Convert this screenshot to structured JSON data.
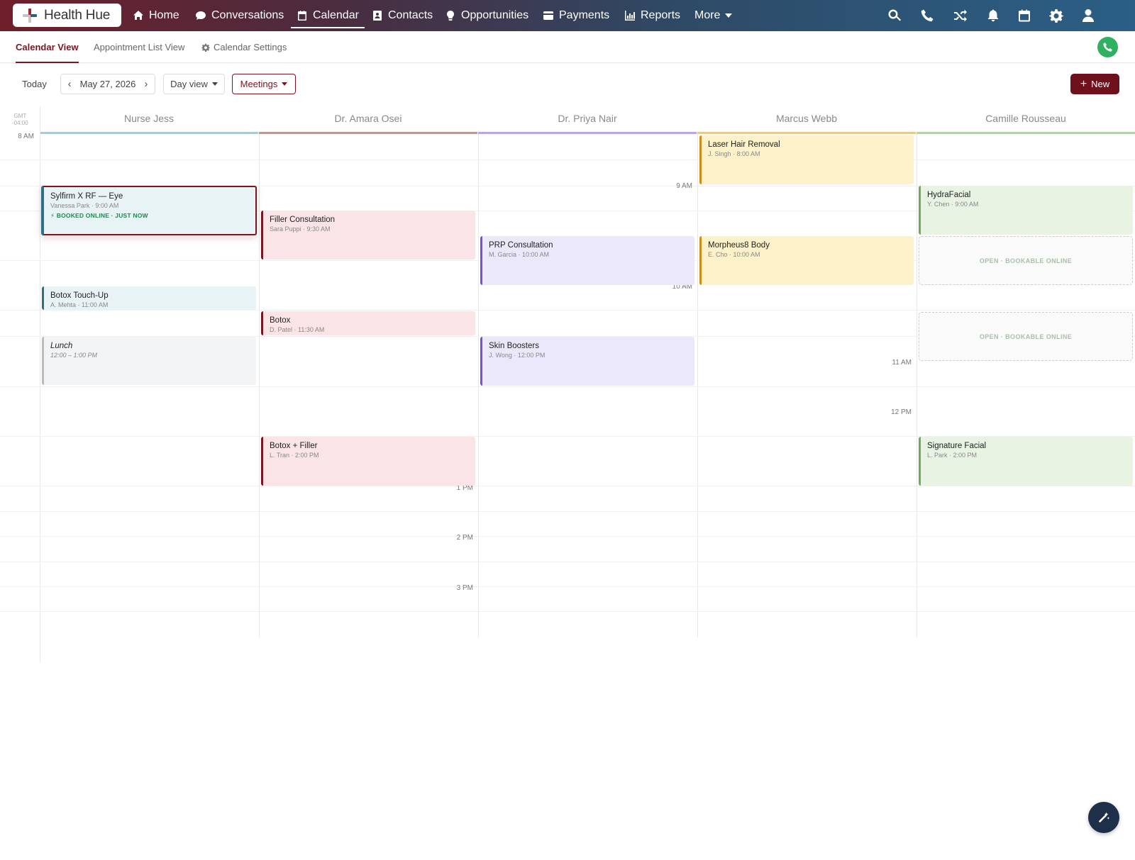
{
  "brand": {
    "name": "Health Hue",
    "colors": {
      "accent": "#7a1522",
      "nav_start": "#6e1f2a",
      "nav_end": "#2b5f86",
      "success": "#2fb160"
    }
  },
  "nav": {
    "items": [
      {
        "label": "Home",
        "icon": "home-icon"
      },
      {
        "label": "Conversations",
        "icon": "chat-icon"
      },
      {
        "label": "Calendar",
        "icon": "calendar-icon",
        "active": true
      },
      {
        "label": "Contacts",
        "icon": "contacts-icon"
      },
      {
        "label": "Opportunities",
        "icon": "lightbulb-icon"
      },
      {
        "label": "Payments",
        "icon": "credit-card-icon"
      },
      {
        "label": "Reports",
        "icon": "bar-chart-icon"
      },
      {
        "label": "More",
        "icon": "chevron-down-icon"
      }
    ],
    "right_icons": [
      "search-icon",
      "phone-icon",
      "shuffle-icon",
      "bell-icon",
      "calendar-icon",
      "gear-icon",
      "user-icon"
    ]
  },
  "subtabs": [
    {
      "label": "Calendar View",
      "active": true
    },
    {
      "label": "Appointment List View"
    },
    {
      "label": "Calendar Settings",
      "icon": "gear-icon"
    }
  ],
  "toolbar": {
    "today": "Today",
    "date": "May 27, 2026",
    "view": "Day view",
    "filter": "Meetings",
    "new": "New"
  },
  "timezone": {
    "line1": "GMT",
    "line2": "-04:00"
  },
  "columns": [
    {
      "name": "Nurse Jess",
      "color": "#a9c9d6"
    },
    {
      "name": "Dr. Amara Osei",
      "color": "#b79a94"
    },
    {
      "name": "Dr. Priya Nair",
      "color": "#b9a6e6"
    },
    {
      "name": "Marcus Webb",
      "color": "#e7c98a"
    },
    {
      "name": "Camille Rousseau",
      "color": "#b9d0ad"
    }
  ],
  "time_labels": [
    "8 AM",
    "9 AM",
    "10 AM",
    "11 AM",
    "12 PM",
    "1 PM",
    "2 PM",
    "3 PM"
  ],
  "appointments": [
    {
      "title": "Sylfirm X RF — Eye",
      "sub": "Vanessa Park · 9:00 AM",
      "badge": "⚡ BOOKED ONLINE · JUST NOW"
    },
    {
      "title": "Botox Touch-Up",
      "sub": "A. Mehta · 11:00 AM"
    },
    {
      "title": "Lunch",
      "sub": "12:00 – 1:00 PM"
    },
    {
      "title": "Filler Consultation",
      "sub": "Sara Puppi · 9:30 AM"
    },
    {
      "title": "Botox",
      "sub": "D. Patel · 11:30 AM"
    },
    {
      "title": "Botox + Filler",
      "sub": "L. Tran · 2:00 PM"
    },
    {
      "title": "PRP Consultation",
      "sub": "M. Garcia · 10:00 AM"
    },
    {
      "title": "Skin Boosters",
      "sub": "J. Wong · 12:00 PM"
    },
    {
      "title": "Laser Hair Removal",
      "sub": "J. Singh · 8:00 AM"
    },
    {
      "title": "Morpheus8 Body",
      "sub": "E. Cho · 10:00 AM"
    },
    {
      "title": "HydraFacial",
      "sub": "Y. Chen · 9:00 AM"
    },
    {
      "title": "Signature Facial",
      "sub": "L. Park · 2:00 PM"
    }
  ],
  "open_slot_label": "OPEN · BOOKABLE ONLINE"
}
